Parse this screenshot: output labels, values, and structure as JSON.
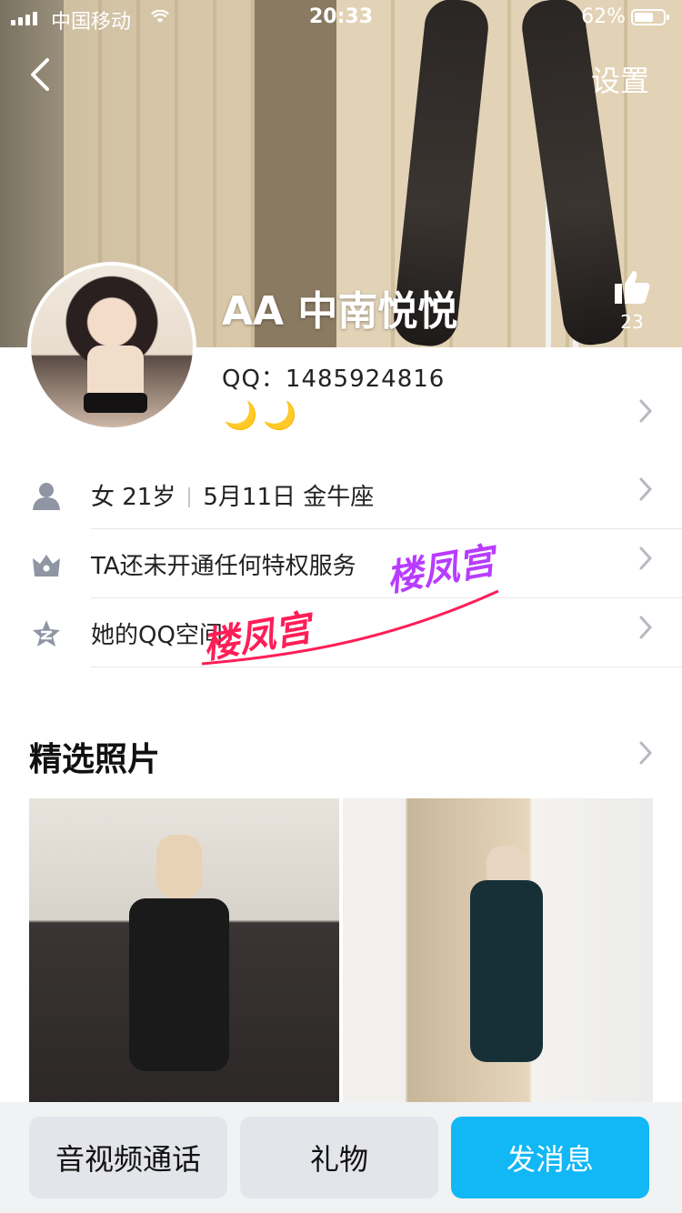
{
  "status_bar": {
    "carrier": "中国移动",
    "time": "20:33",
    "battery": "62%"
  },
  "header": {
    "settings_label": "设置",
    "nickname": "AA 中南悦悦",
    "like_count": "23"
  },
  "profile": {
    "qq_label": "QQ：1485924816",
    "moons": [
      "🌙",
      "🌙"
    ]
  },
  "info_rows": [
    {
      "icon": "person-icon",
      "text_a": "女 21岁",
      "text_b": "5月11日 金牛座"
    },
    {
      "icon": "crown-icon",
      "text": "TA还未开通任何特权服务"
    },
    {
      "icon": "qzone-icon",
      "text": "她的QQ空间"
    }
  ],
  "watermark": {
    "text_1": "楼凤宫",
    "text_2": "楼凤宫",
    "color_1": "#ff1e57",
    "color_2": "#b83cff"
  },
  "photos_section": {
    "title": "精选照片"
  },
  "actions": {
    "call": "音视频通话",
    "gift": "礼物",
    "message": "发消息"
  },
  "colors": {
    "accent": "#12b7f5",
    "secondary_button": "#e3e5ea"
  }
}
